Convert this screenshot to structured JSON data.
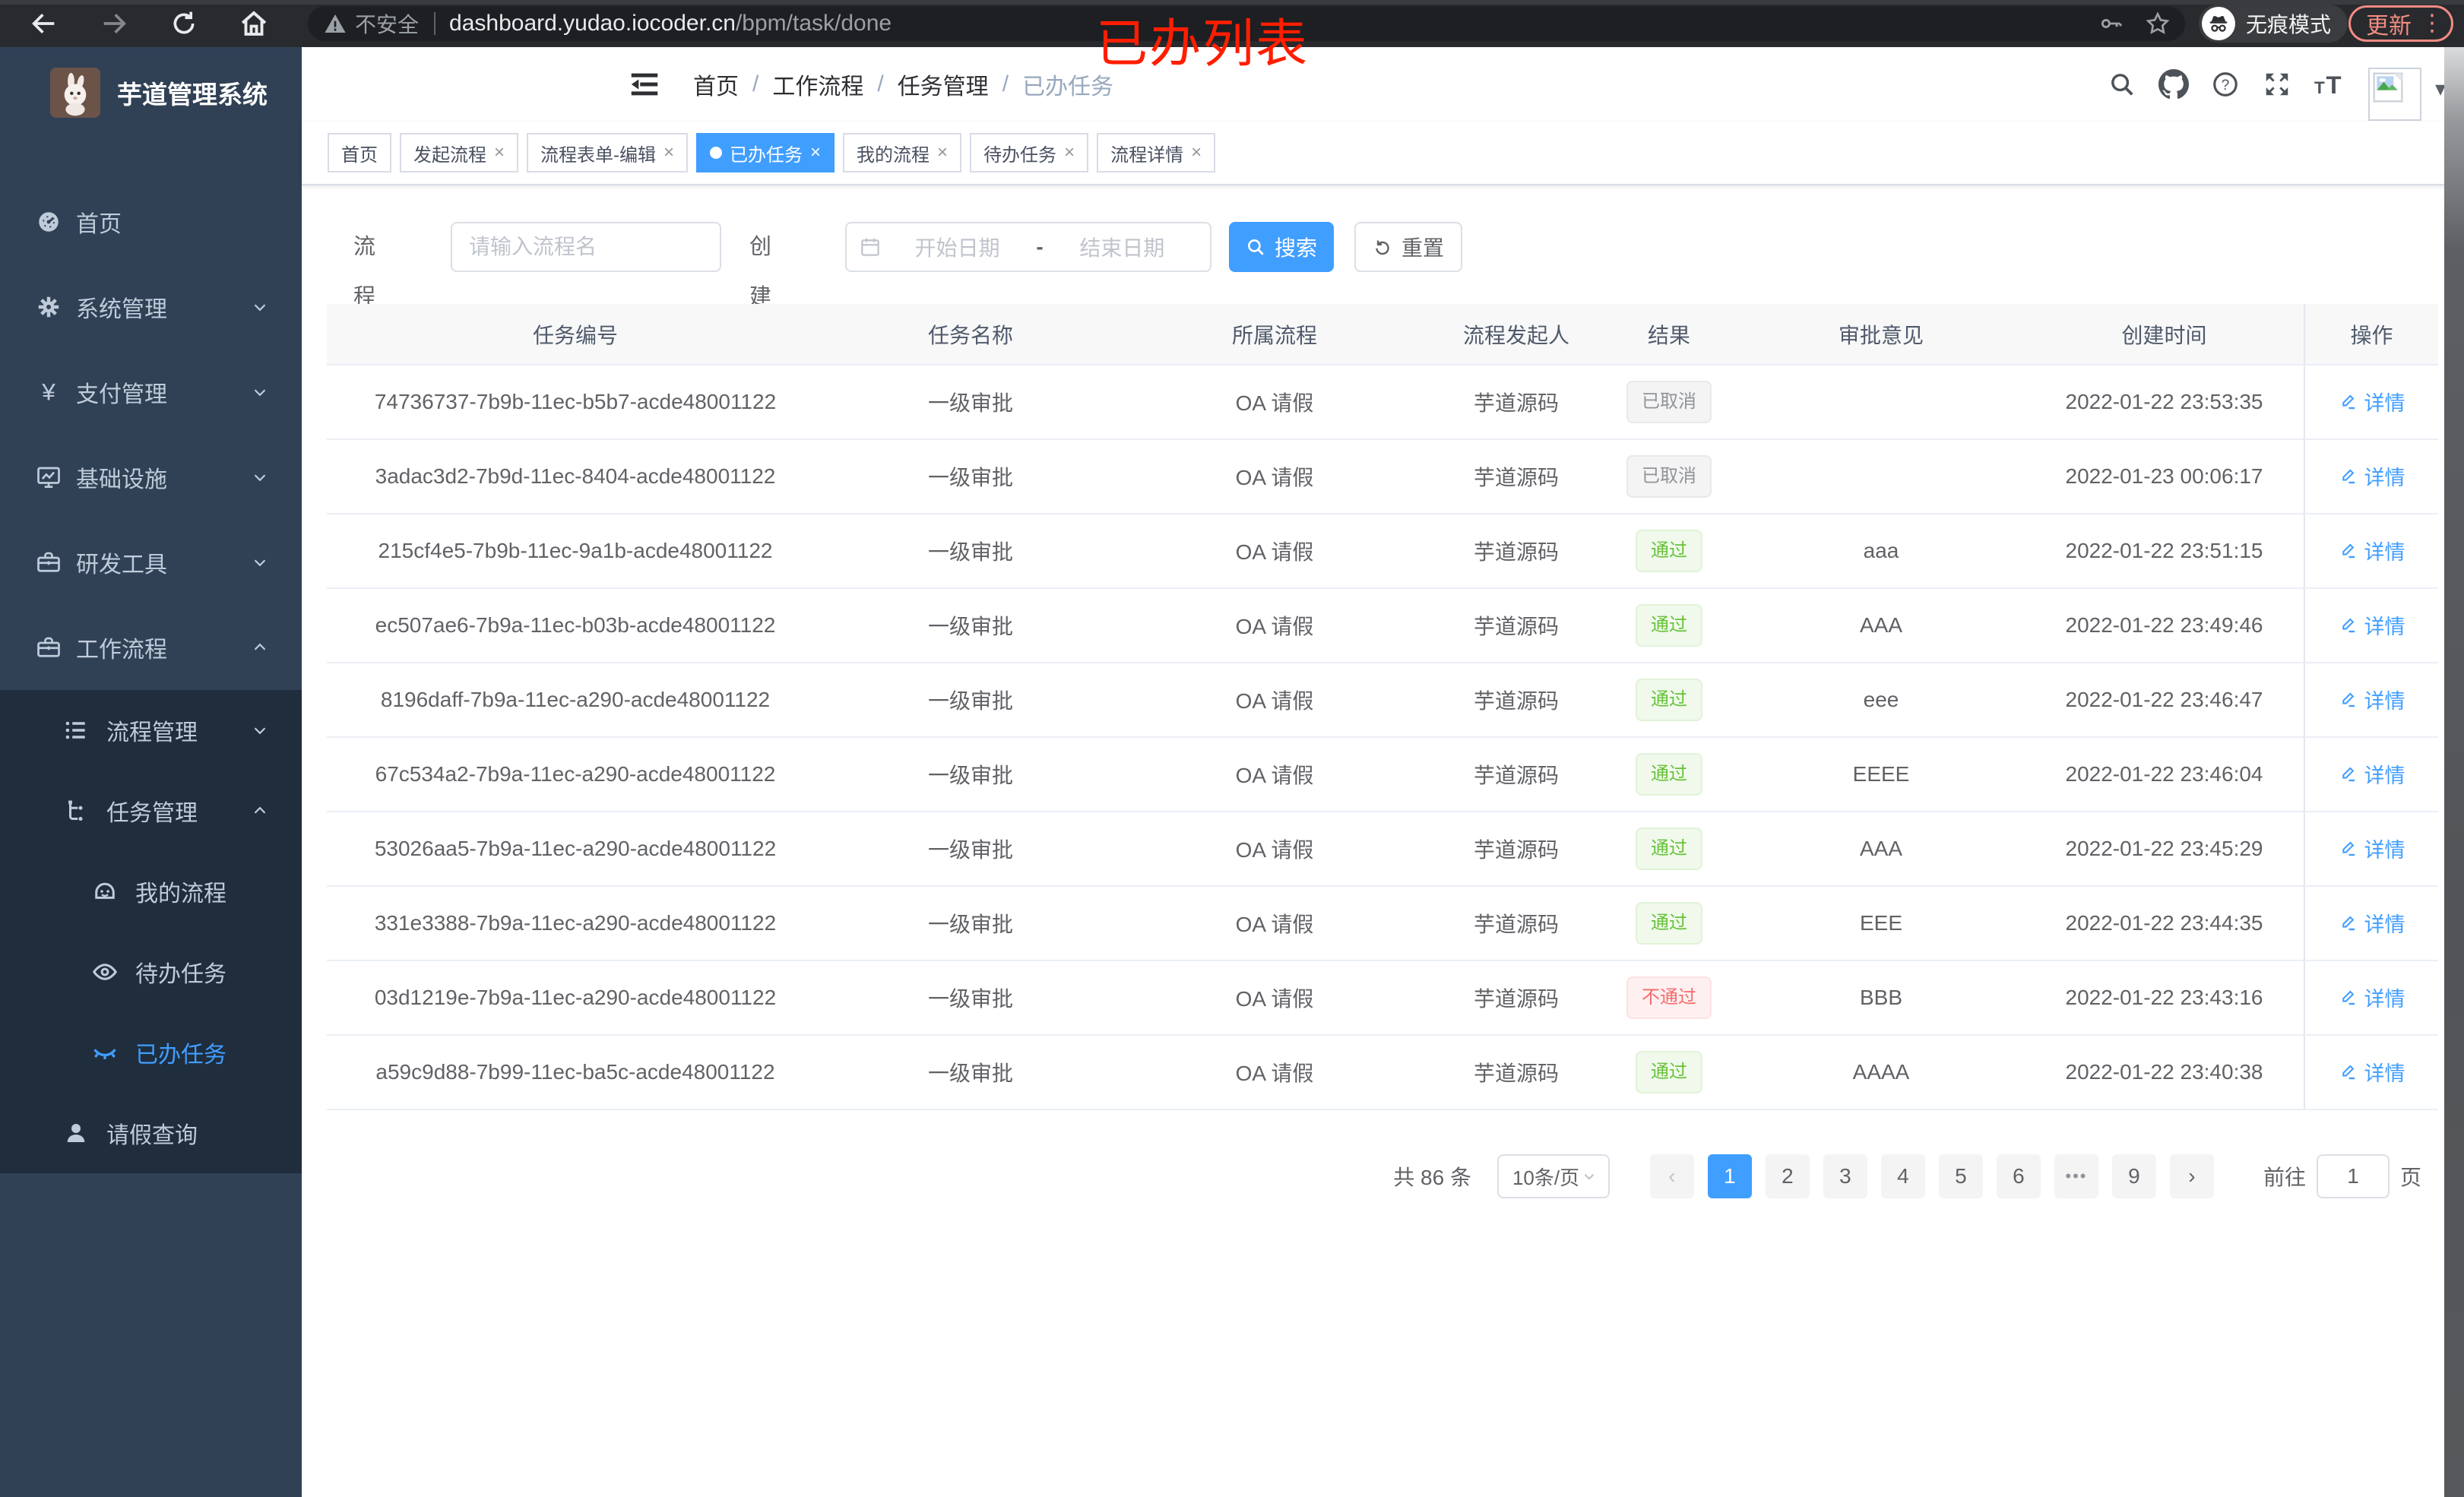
{
  "browser": {
    "security_label": "不安全",
    "url_host": "dashboard.yudao.iocoder.cn",
    "url_path": "/bpm/task/done",
    "incognito_label": "无痕模式",
    "update_label": "更新",
    "update_dots": "⋮"
  },
  "annotation": {
    "title": "已办列表",
    "color": "#ff1e00"
  },
  "sidebar": {
    "logo_title": "芋道管理系统",
    "items": [
      {
        "label": "首页",
        "icon": "dashboard-icon",
        "level": 1,
        "section": "root",
        "chevron": ""
      },
      {
        "label": "系统管理",
        "icon": "gear-icon",
        "level": 1,
        "section": "root",
        "chevron": "down"
      },
      {
        "label": "支付管理",
        "icon": "yen-icon",
        "level": 1,
        "section": "root",
        "chevron": "down"
      },
      {
        "label": "基础设施",
        "icon": "monitor-icon",
        "level": 1,
        "section": "root",
        "chevron": "down"
      },
      {
        "label": "研发工具",
        "icon": "toolbox-icon",
        "level": 1,
        "section": "root",
        "chevron": "down"
      },
      {
        "label": "工作流程",
        "icon": "briefcase-icon",
        "level": 1,
        "section": "root",
        "chevron": "up"
      },
      {
        "label": "流程管理",
        "icon": "list-icon",
        "level": 2,
        "section": "sub",
        "chevron": "down"
      },
      {
        "label": "任务管理",
        "icon": "tree-icon",
        "level": 2,
        "section": "sub",
        "chevron": "up"
      },
      {
        "label": "我的流程",
        "icon": "robot-icon",
        "level": 3,
        "section": "sub",
        "chevron": ""
      },
      {
        "label": "待办任务",
        "icon": "eye-open-icon",
        "level": 3,
        "section": "sub",
        "chevron": ""
      },
      {
        "label": "已办任务",
        "icon": "eye-closed-icon",
        "level": 3,
        "section": "sub",
        "chevron": "",
        "active": true
      },
      {
        "label": "请假查询",
        "icon": "user-icon",
        "level": 2,
        "section": "sub",
        "chevron": ""
      }
    ]
  },
  "header": {
    "breadcrumb": [
      "首页",
      "工作流程",
      "任务管理",
      "已办任务"
    ]
  },
  "tabs": [
    {
      "label": "首页",
      "closable": false,
      "active": false
    },
    {
      "label": "发起流程",
      "closable": true,
      "active": false
    },
    {
      "label": "流程表单-编辑",
      "closable": true,
      "active": false
    },
    {
      "label": "已办任务",
      "closable": true,
      "active": true
    },
    {
      "label": "我的流程",
      "closable": true,
      "active": false
    },
    {
      "label": "待办任务",
      "closable": true,
      "active": false
    },
    {
      "label": "流程详情",
      "closable": true,
      "active": false
    }
  ],
  "filters": {
    "name_label": "流程名",
    "name_placeholder": "请输入流程名",
    "date_label": "创建时间",
    "date_start_placeholder": "开始日期",
    "date_separator": "-",
    "date_end_placeholder": "结束日期",
    "search_label": "搜索",
    "reset_label": "重置"
  },
  "table": {
    "columns": [
      "任务编号",
      "任务名称",
      "所属流程",
      "流程发起人",
      "结果",
      "审批意见",
      "创建时间",
      "操作"
    ],
    "action_label": "详情",
    "rows": [
      {
        "id": "74736737-7b9b-11ec-b5b7-acde48001122",
        "name": "一级审批",
        "process": "OA 请假",
        "starter": "芋道源码",
        "result": "已取消",
        "result_type": "info",
        "comment": "",
        "created": "2022-01-22 23:53:35"
      },
      {
        "id": "3adac3d2-7b9d-11ec-8404-acde48001122",
        "name": "一级审批",
        "process": "OA 请假",
        "starter": "芋道源码",
        "result": "已取消",
        "result_type": "info",
        "comment": "",
        "created": "2022-01-23 00:06:17"
      },
      {
        "id": "215cf4e5-7b9b-11ec-9a1b-acde48001122",
        "name": "一级审批",
        "process": "OA 请假",
        "starter": "芋道源码",
        "result": "通过",
        "result_type": "success",
        "comment": "aaa",
        "created": "2022-01-22 23:51:15"
      },
      {
        "id": "ec507ae6-7b9a-11ec-b03b-acde48001122",
        "name": "一级审批",
        "process": "OA 请假",
        "starter": "芋道源码",
        "result": "通过",
        "result_type": "success",
        "comment": "AAA",
        "created": "2022-01-22 23:49:46"
      },
      {
        "id": "8196daff-7b9a-11ec-a290-acde48001122",
        "name": "一级审批",
        "process": "OA 请假",
        "starter": "芋道源码",
        "result": "通过",
        "result_type": "success",
        "comment": "eee",
        "created": "2022-01-22 23:46:47"
      },
      {
        "id": "67c534a2-7b9a-11ec-a290-acde48001122",
        "name": "一级审批",
        "process": "OA 请假",
        "starter": "芋道源码",
        "result": "通过",
        "result_type": "success",
        "comment": "EEEE",
        "created": "2022-01-22 23:46:04"
      },
      {
        "id": "53026aa5-7b9a-11ec-a290-acde48001122",
        "name": "一级审批",
        "process": "OA 请假",
        "starter": "芋道源码",
        "result": "通过",
        "result_type": "success",
        "comment": "AAA",
        "created": "2022-01-22 23:45:29"
      },
      {
        "id": "331e3388-7b9a-11ec-a290-acde48001122",
        "name": "一级审批",
        "process": "OA 请假",
        "starter": "芋道源码",
        "result": "通过",
        "result_type": "success",
        "comment": "EEE",
        "created": "2022-01-22 23:44:35"
      },
      {
        "id": "03d1219e-7b9a-11ec-a290-acde48001122",
        "name": "一级审批",
        "process": "OA 请假",
        "starter": "芋道源码",
        "result": "不通过",
        "result_type": "danger",
        "comment": "BBB",
        "created": "2022-01-22 23:43:16"
      },
      {
        "id": "a59c9d88-7b99-11ec-ba5c-acde48001122",
        "name": "一级审批",
        "process": "OA 请假",
        "starter": "芋道源码",
        "result": "通过",
        "result_type": "success",
        "comment": "AAAA",
        "created": "2022-01-22 23:40:38"
      }
    ]
  },
  "pagination": {
    "total_label": "共 86 条",
    "page_size": "10条/页",
    "prev": "‹",
    "next": "›",
    "pages": [
      "1",
      "2",
      "3",
      "4",
      "5",
      "6",
      "•••",
      "9"
    ],
    "active_page": "1",
    "goto_label": "前往",
    "goto_value": "1",
    "page_unit": "页"
  },
  "colors": {
    "accent": "#409eff",
    "success": "#67c23a",
    "info": "#909399",
    "danger": "#f56c6c",
    "sidebar_bg": "#304156",
    "submenu_bg": "#1f2d3d",
    "update_button": "#f28b82",
    "annotation": "#ff1e00"
  }
}
